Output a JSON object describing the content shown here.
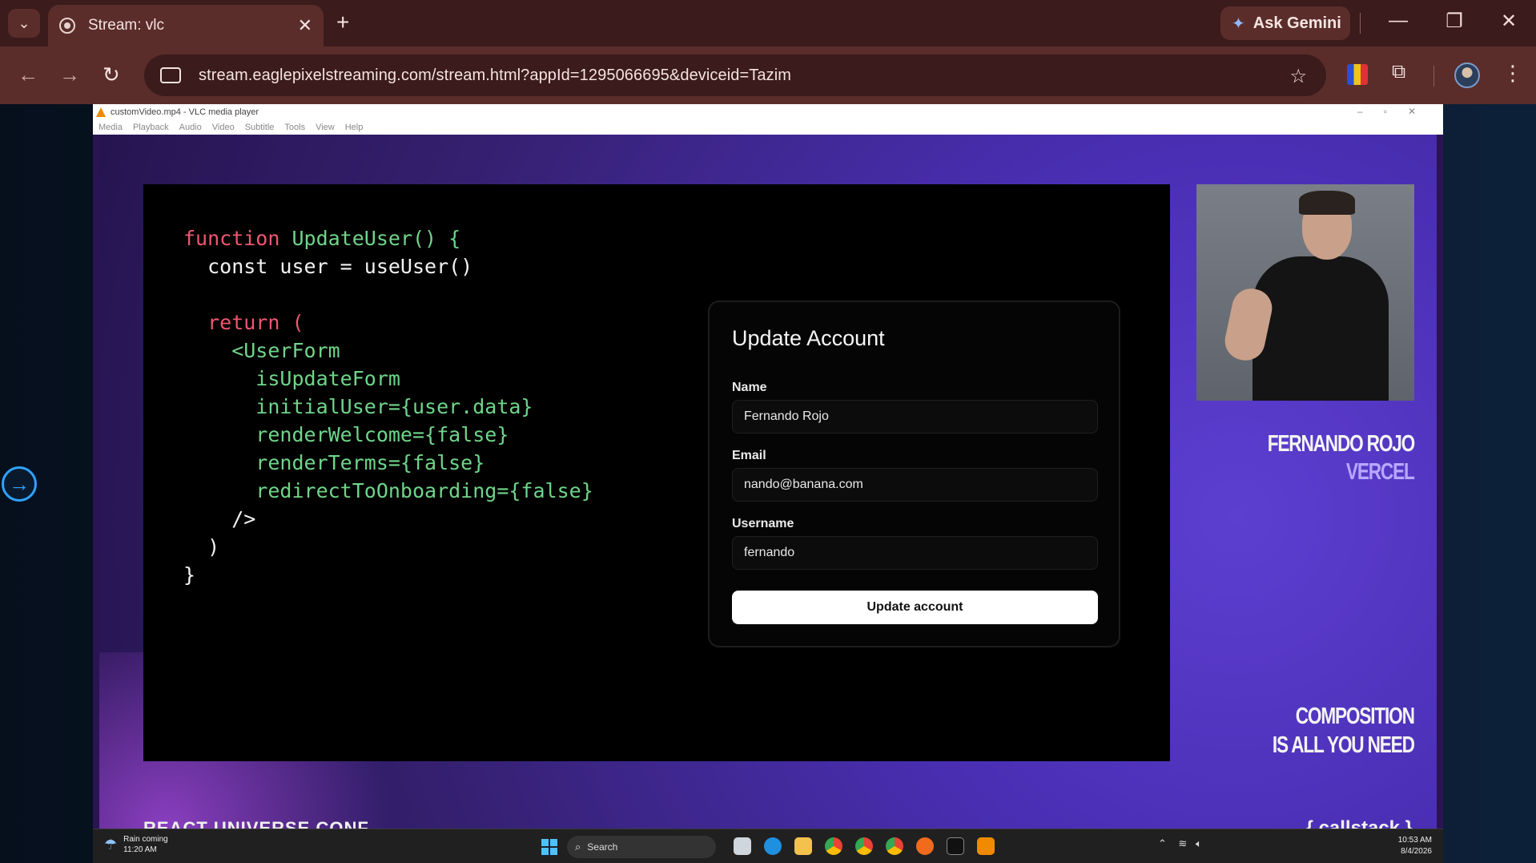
{
  "browser": {
    "tab_title": "Stream: vlc",
    "url": "stream.eaglepixelstreaming.com/stream.html?appId=1295066695&deviceid=Tazim",
    "gemini_label": "Ask Gemini",
    "icons": [
      "chevron-down-icon",
      "tab-favicon",
      "close-icon",
      "plus-icon",
      "back-icon",
      "forward-icon",
      "reload-icon",
      "site-info-icon",
      "star-icon",
      "extension-icon",
      "profile-avatar",
      "menu-icon"
    ]
  },
  "vlc": {
    "title": "customVideo.mp4 - VLC media player",
    "menu": [
      "Media",
      "Playback",
      "Audio",
      "Video",
      "Subtitle",
      "Tools",
      "View",
      "Help"
    ]
  },
  "slide": {
    "code_lines": [
      "function UpdateUser() {",
      "  const user = useUser()",
      "",
      "  return (",
      "    <UserForm",
      "      isUpdateForm",
      "      initialUser={user.data}",
      "      renderWelcome={false}",
      "      renderTerms={false}",
      "      redirectToOnboarding={false}",
      "    />",
      "  )",
      "}"
    ],
    "card": {
      "title": "Update Account",
      "name_label": "Name",
      "name_value": "Fernando Rojo",
      "email_label": "Email",
      "email_value": "nando@banana.com",
      "username_label": "Username",
      "username_value": "fernando",
      "button_label": "Update account"
    }
  },
  "speaker": {
    "name": "FERNANDO ROJO",
    "company": "VERCEL",
    "talk_line1": "COMPOSITION",
    "talk_line2": "IS ALL YOU NEED"
  },
  "stream_bottom": {
    "left_text": "REACT UNIVERSE CONF",
    "right_text": "{ callstack }"
  },
  "taskbar": {
    "weather_title": "Rain coming",
    "weather_time": "11:20 AM",
    "search_label": "Search",
    "clock_time": "10:53 AM",
    "clock_date": "8/4/2026"
  }
}
